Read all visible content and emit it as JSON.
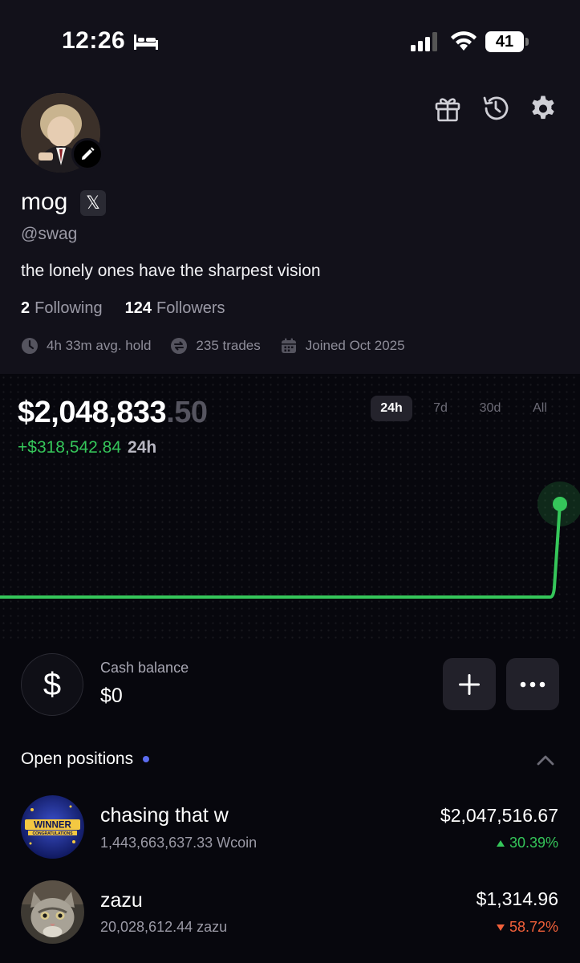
{
  "status_bar": {
    "time": "12:26",
    "battery": "41",
    "icons": [
      "bed-icon",
      "signal-icon",
      "wifi-icon",
      "battery-icon"
    ]
  },
  "header_actions": [
    "gift-icon",
    "history-icon",
    "gear-icon"
  ],
  "profile": {
    "name": "mog",
    "x_badge": "𝕏",
    "handle": "@swag",
    "bio": "the lonely ones have the sharpest vision",
    "following_count": "2",
    "following_label": "Following",
    "followers_count": "124",
    "followers_label": "Followers",
    "avg_hold": "4h 33m avg. hold",
    "trades": "235 trades",
    "joined": "Joined Oct 2025"
  },
  "portfolio": {
    "balance_main": "$2,048,833",
    "balance_cents": ".50",
    "change": "+$318,542.84",
    "change_period": "24h",
    "ranges": [
      "24h",
      "7d",
      "30d",
      "All"
    ],
    "active_range": "24h"
  },
  "chart_data": {
    "type": "line",
    "series": [
      {
        "values": [
          0,
          0,
          0,
          0,
          0,
          0,
          0,
          0,
          0,
          0,
          1
        ]
      }
    ],
    "color": "#35c65a"
  },
  "cash": {
    "symbol": "$",
    "label": "Cash balance",
    "value": "$0",
    "add_symbol": "+",
    "more_symbol": "•••"
  },
  "positions": {
    "title": "Open positions",
    "items": [
      {
        "name": "chasing that w",
        "amount": "1,443,663,637.33 Wcoin",
        "value": "$2,047,516.67",
        "change": "30.39%",
        "direction": "up",
        "logo_text": "WINNER",
        "logo_subtext": "CONGRATULATIONS"
      },
      {
        "name": "zazu",
        "amount": "20,028,612.44 zazu",
        "value": "$1,314.96",
        "change": "58.72%",
        "direction": "down"
      }
    ]
  },
  "colors": {
    "background": "#07070d",
    "profile_bg": "#12111a",
    "accent_green": "#35c65a",
    "accent_red": "#f1603a",
    "accent_blue": "#5b6cf0"
  }
}
